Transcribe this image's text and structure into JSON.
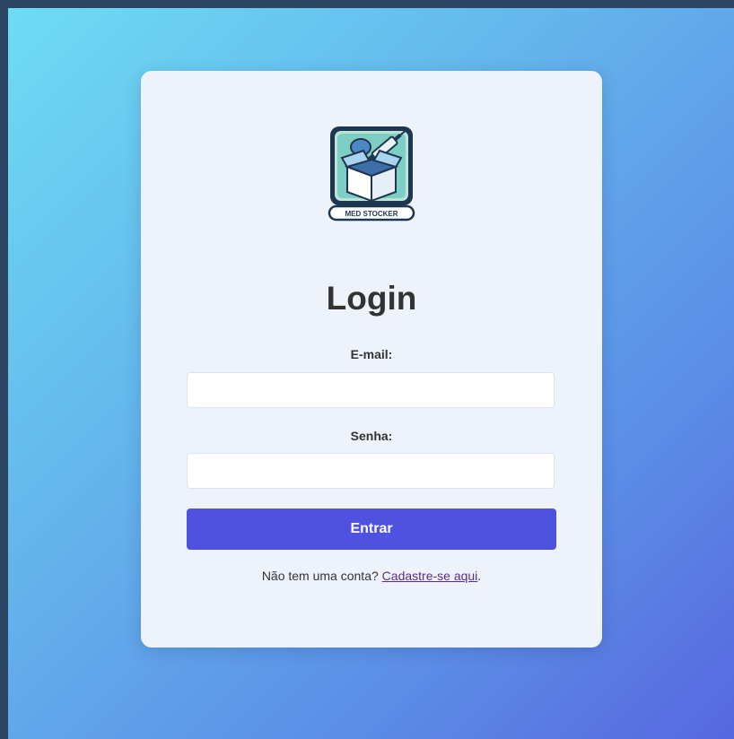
{
  "logo": {
    "text": "MED STOCKER",
    "icon": "open-box-medical-icon"
  },
  "form": {
    "title": "Login",
    "email_label": "E-mail:",
    "email_value": "",
    "password_label": "Senha:",
    "password_value": "",
    "submit_label": "Entrar"
  },
  "signup": {
    "prompt": "Não tem uma conta? ",
    "link_label": "Cadastre-se aqui",
    "suffix": "."
  },
  "colors": {
    "button": "#4f51e1",
    "card": "#eef3fb",
    "gradient_start": "#6ddcf3",
    "gradient_end": "#5767e0",
    "link": "#5a2d8c"
  }
}
